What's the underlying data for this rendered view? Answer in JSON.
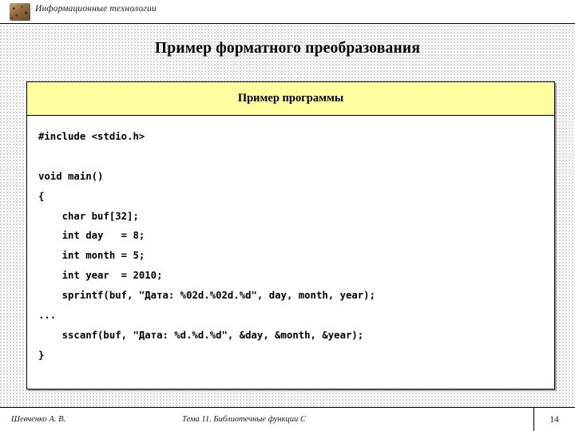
{
  "header": {
    "icon": "books-icon",
    "title": "Информационные технологии"
  },
  "slide": {
    "title": "Пример форматного преобразования"
  },
  "panel": {
    "header_label": "Пример программы",
    "header_bg": "#ffffa0",
    "border_color": "#000000",
    "code_lines": [
      "#include <stdio.h>",
      "",
      "void main()",
      "{",
      "    char buf[32];",
      "    int day   = 8;",
      "    int month = 5;",
      "    int year  = 2010;",
      "    sprintf(buf, \"Дата: %02d.%02d.%d\", day, month, year);",
      "...",
      "    sscanf(buf, \"Дата: %d.%d.%d\", &day, &month, &year);",
      "}"
    ]
  },
  "footer": {
    "author": "Шевченко А. В.",
    "topic": "Тема 11. Библиотечные функции С",
    "page": "14"
  }
}
